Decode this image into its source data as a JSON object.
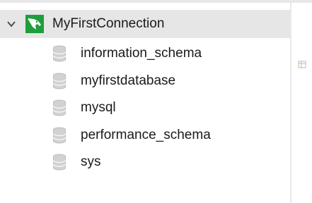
{
  "navigator": {
    "connection": {
      "label": "MyFirstConnection",
      "expanded": true,
      "icon": "mysql-dolphin-connection-icon",
      "accent_color": "#1e9e3c"
    },
    "schemas": [
      {
        "label": "information_schema",
        "icon": "database-icon"
      },
      {
        "label": "myfirstdatabase",
        "icon": "database-icon"
      },
      {
        "label": "mysql",
        "icon": "database-icon"
      },
      {
        "label": "performance_schema",
        "icon": "database-icon"
      },
      {
        "label": "sys",
        "icon": "database-icon"
      }
    ]
  }
}
